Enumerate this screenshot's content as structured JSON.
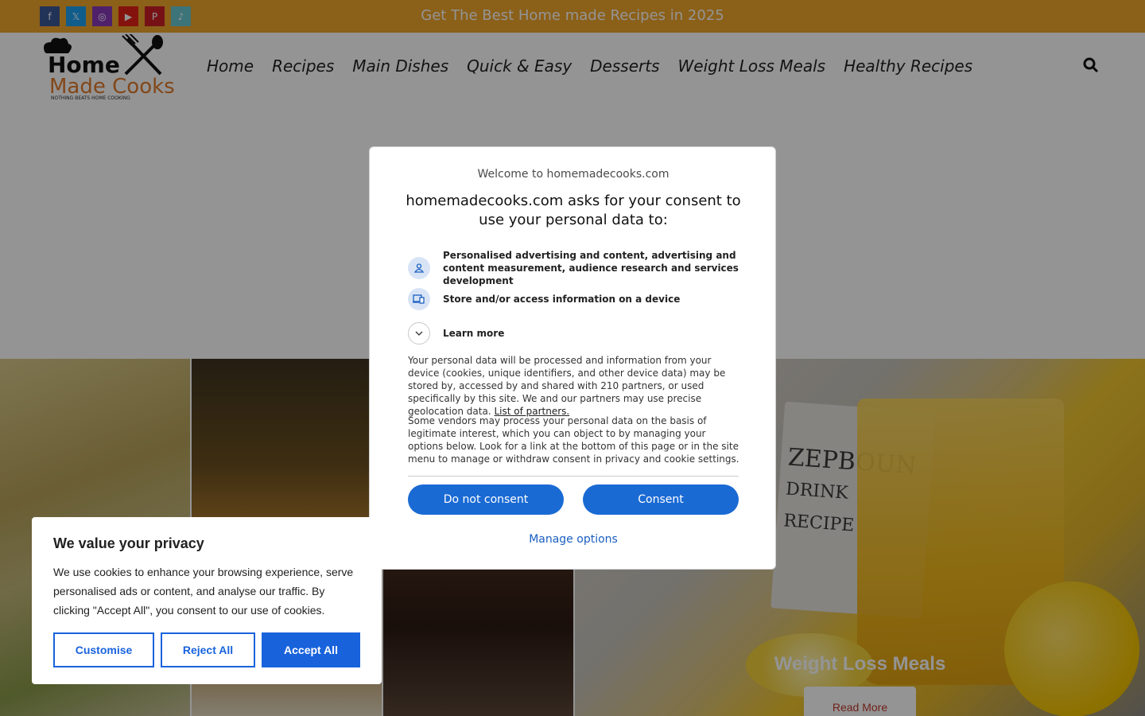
{
  "topbar": {
    "text": "Get The Best Home made Recipes in 2025",
    "socials": [
      {
        "icon": "facebook-icon",
        "color": "#3b5998",
        "glyph": "f"
      },
      {
        "icon": "x-twitter-icon",
        "color": "#1da1f2",
        "glyph": "𝕏"
      },
      {
        "icon": "instagram-icon",
        "color": "#8a3ab9",
        "glyph": "◎"
      },
      {
        "icon": "youtube-icon",
        "color": "#e62117",
        "glyph": "▶"
      },
      {
        "icon": "pinterest-icon",
        "color": "#cb2027",
        "glyph": "P"
      },
      {
        "icon": "tiktok-icon",
        "color": "#69c9d0",
        "glyph": "♪"
      }
    ],
    "bg_color": "#f0a62b"
  },
  "header": {
    "logo": {
      "line1": "Home",
      "line2": "Made Cooks",
      "tagline": "NOTHING BEATS HOME COOKING"
    },
    "nav": [
      "Home",
      "Recipes",
      "Main Dishes",
      "Quick & Easy",
      "Desserts",
      "Weight Loss Meals",
      "Healthy Recipes"
    ]
  },
  "hero": {
    "tile_title": "Weight Loss Meals",
    "read_more": "Read More",
    "pad_text": [
      "ZEPBOUN",
      "DRINK",
      "RECIPE"
    ]
  },
  "consent_dialog": {
    "welcome": "Welcome to homemadecooks.com",
    "title": "homemadecooks.com asks for your consent to use your personal data to:",
    "items": [
      {
        "icon": "person-icon",
        "text": "Personalised advertising and content, advertising and content measurement, audience research and services development"
      },
      {
        "icon": "devices-icon",
        "text": "Store and/or access information on a device"
      },
      {
        "icon": "chevron-down-icon",
        "text": "Learn more"
      }
    ],
    "para1": "Your personal data will be processed and information from your device (cookies, unique identifiers, and other device data) may be stored by, accessed by and shared with 210 partners, or used specifically by this site. We and our partners may use precise geolocation data.",
    "partners_link": "List of partners.",
    "para2": "Some vendors may process your personal data on the basis of legitimate interest, which you can object to by managing your options below. Look for a link at the bottom of this page or in the site menu to manage or withdraw consent in privacy and cookie settings.",
    "do_not_consent": "Do not consent",
    "consent": "Consent",
    "manage_options": "Manage options",
    "accent_color": "#1a6ad4"
  },
  "cookie_banner": {
    "title": "We value your privacy",
    "text": "We use cookies to enhance your browsing experience, serve personalised ads or content, and analyse our traffic. By clicking \"Accept All\", you consent to our use of cookies.",
    "customise": "Customise",
    "reject_all": "Reject All",
    "accept_all": "Accept All",
    "accent_color": "#1863dc"
  }
}
